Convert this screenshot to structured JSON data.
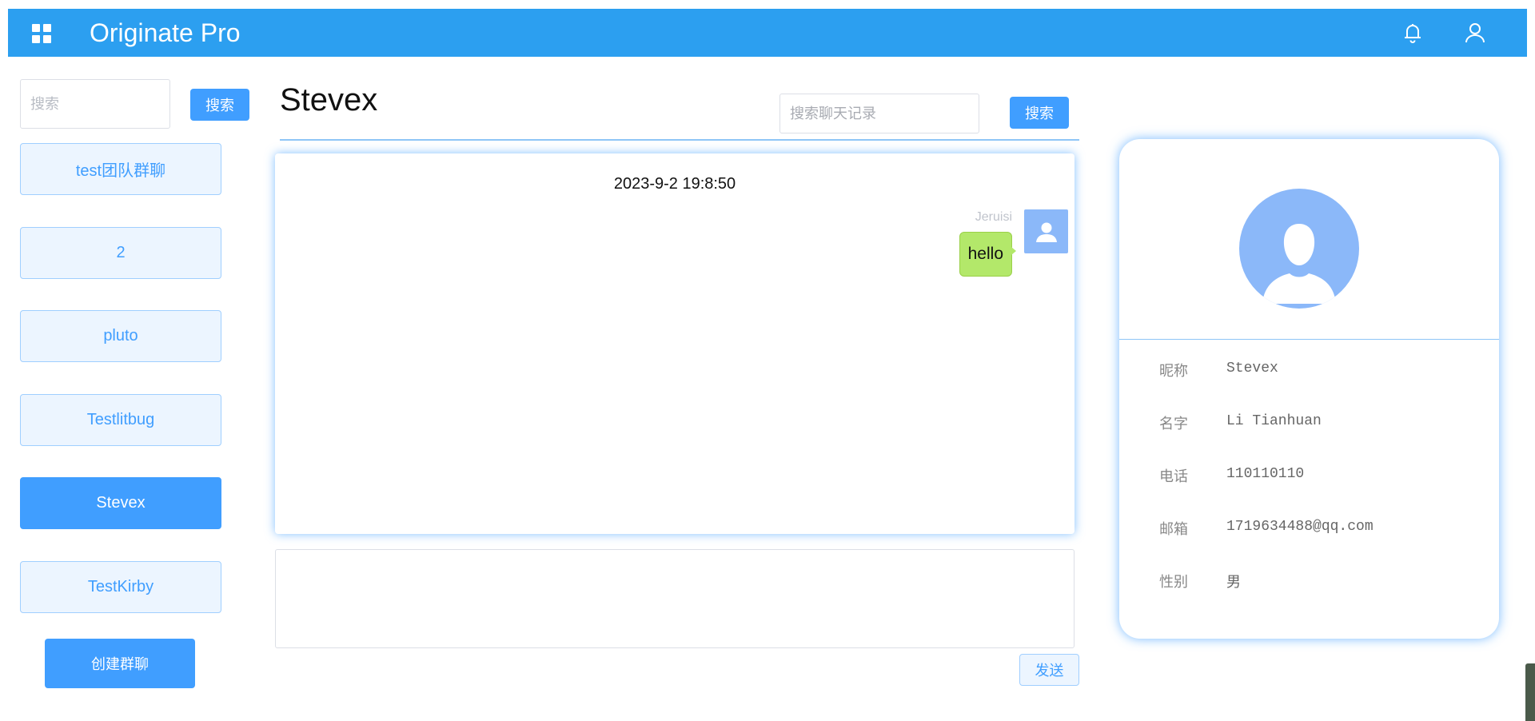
{
  "app": {
    "title": "Originate Pro"
  },
  "icons": {
    "menu": "grid-icon",
    "notifications": "bell-icon",
    "account": "user-icon",
    "avatar": "user-silhouette-icon"
  },
  "colors": {
    "primary": "#2c9ff0",
    "button": "#409eff",
    "bubble": "#b3e86a",
    "avatar": "#8bb8f9"
  },
  "sidebar": {
    "search_placeholder": "搜索",
    "search_button": "搜索",
    "contacts": [
      "test团队群聊",
      "2",
      "pluto",
      "Testlitbug",
      "Stevex",
      "TestKirby"
    ],
    "active_contact": "Stevex",
    "create_group_button": "创建群聊"
  },
  "chat": {
    "title": "Stevex",
    "search_placeholder": "搜索聊天记录",
    "search_button": "搜索",
    "messages": [
      {
        "time": "2023-9-2 19:8:50",
        "sender": "Jeruisi",
        "text": "hello"
      }
    ],
    "composer_value": "",
    "send_button": "发送"
  },
  "profile": {
    "fields": [
      {
        "label": "昵称",
        "value": "Stevex"
      },
      {
        "label": "名字",
        "value": "Li Tianhuan"
      },
      {
        "label": "电话",
        "value": "110110110"
      },
      {
        "label": "邮箱",
        "value": "1719634488@qq.com"
      },
      {
        "label": "性别",
        "value": "男"
      }
    ]
  }
}
